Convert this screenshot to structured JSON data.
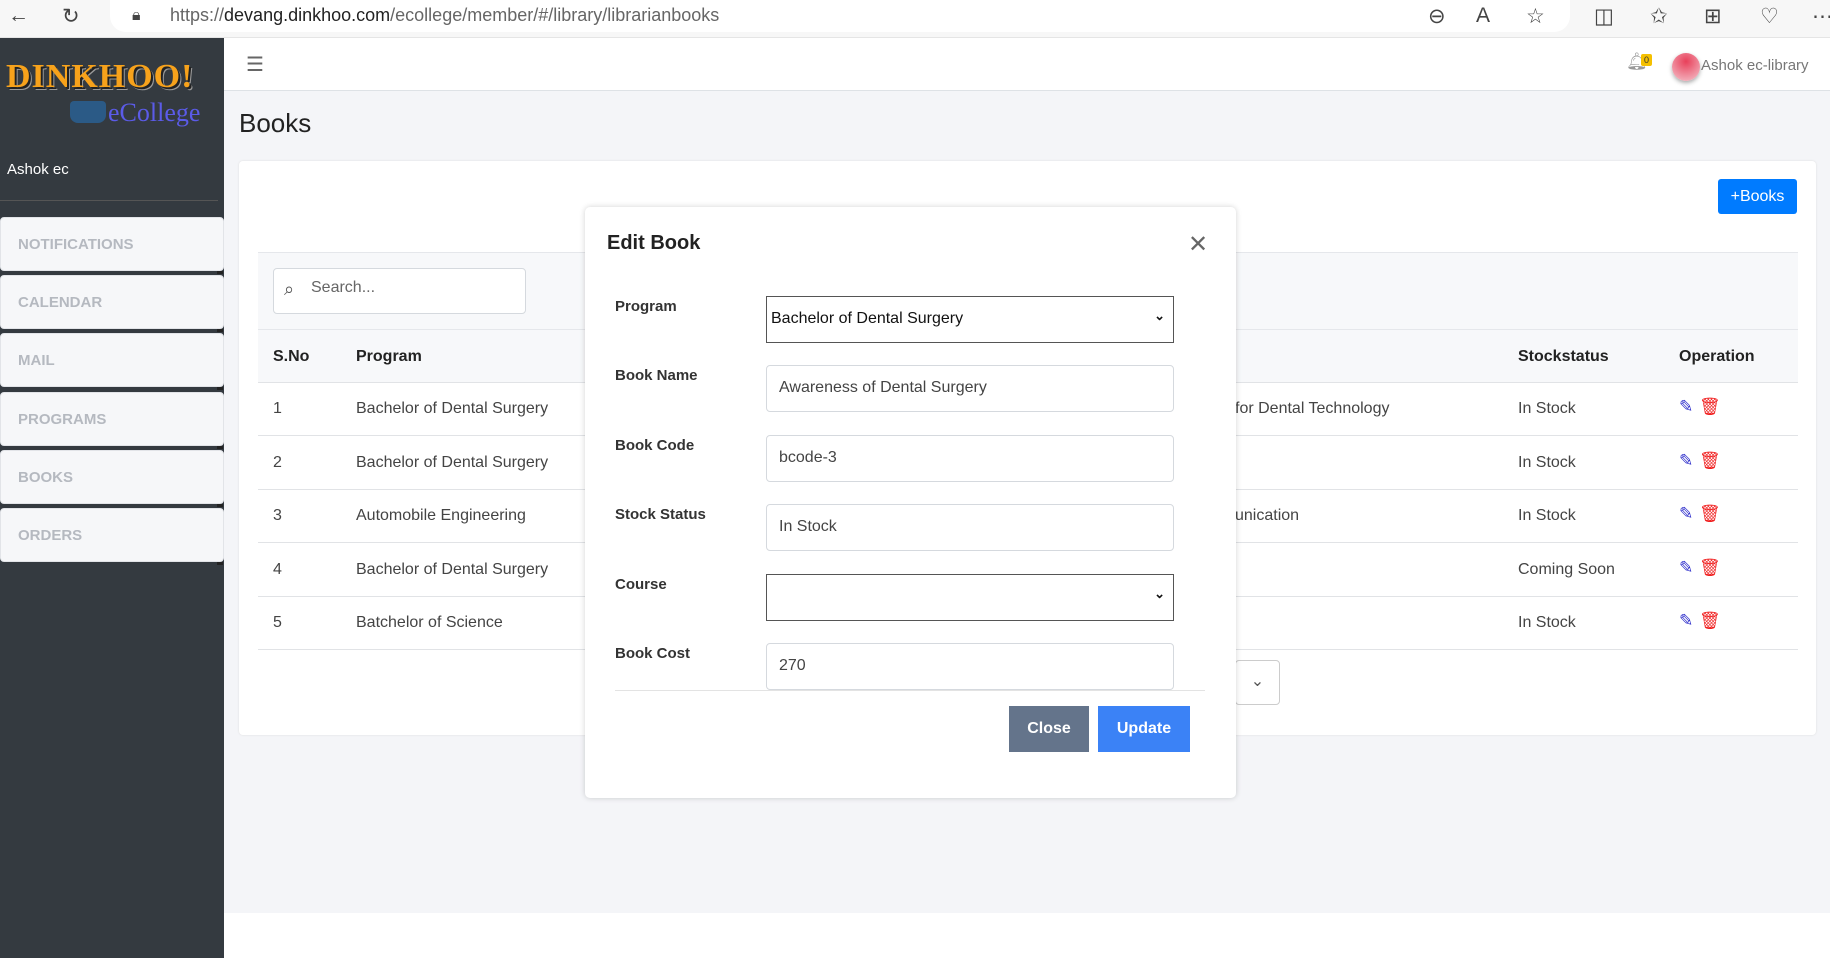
{
  "browser": {
    "url_prefix": "https://",
    "url_domain": "devang.dinkhoo.com",
    "url_path": "/ecollege/member/#/library/librarianbooks"
  },
  "sidebar": {
    "logo_text": "DINKHOO!",
    "logo_sub": "eCollege",
    "user": "Ashok ec",
    "items": [
      {
        "label": "NOTIFICATIONS"
      },
      {
        "label": "CALENDAR"
      },
      {
        "label": "MAIL"
      },
      {
        "label": "PROGRAMS"
      },
      {
        "label": "BOOKS"
      },
      {
        "label": "ORDERS"
      }
    ]
  },
  "header": {
    "notification_count": "0",
    "user_name": "Ashok ec-library"
  },
  "page": {
    "title": "Books",
    "add_button": "+Books",
    "search_placeholder": "Search..."
  },
  "table": {
    "columns": [
      "S.No",
      "Program",
      "",
      "Stockstatus",
      "Operation"
    ],
    "rows": [
      {
        "sno": "1",
        "program": "Bachelor of Dental Surgery",
        "other": "for Dental Technology",
        "stock": "In Stock"
      },
      {
        "sno": "2",
        "program": "Bachelor of Dental Surgery",
        "other": "",
        "stock": "In Stock"
      },
      {
        "sno": "3",
        "program": "Automobile Engineering",
        "other": "unication",
        "stock": "In Stock"
      },
      {
        "sno": "4",
        "program": "Bachelor of Dental Surgery",
        "other": "",
        "stock": "Coming Soon"
      },
      {
        "sno": "5",
        "program": "Batchelor of Science",
        "other": "",
        "stock": "In Stock"
      }
    ]
  },
  "modal": {
    "title": "Edit Book",
    "fields": {
      "program": {
        "label": "Program",
        "value": "Bachelor of Dental Surgery"
      },
      "book_name": {
        "label": "Book Name",
        "value": "Awareness of Dental Surgery"
      },
      "book_code": {
        "label": "Book Code",
        "value": "bcode-3"
      },
      "stock_status": {
        "label": "Stock Status",
        "value": "In Stock"
      },
      "course": {
        "label": "Course",
        "value": ""
      },
      "book_cost": {
        "label": "Book Cost",
        "value": "270"
      }
    },
    "close_label": "Close",
    "update_label": "Update"
  },
  "colors": {
    "primary": "#007bff",
    "update": "#3b82f6",
    "close": "#64748b",
    "delete": "#f01f1f",
    "edit": "#3333cc",
    "sidebar": "#343a40"
  }
}
